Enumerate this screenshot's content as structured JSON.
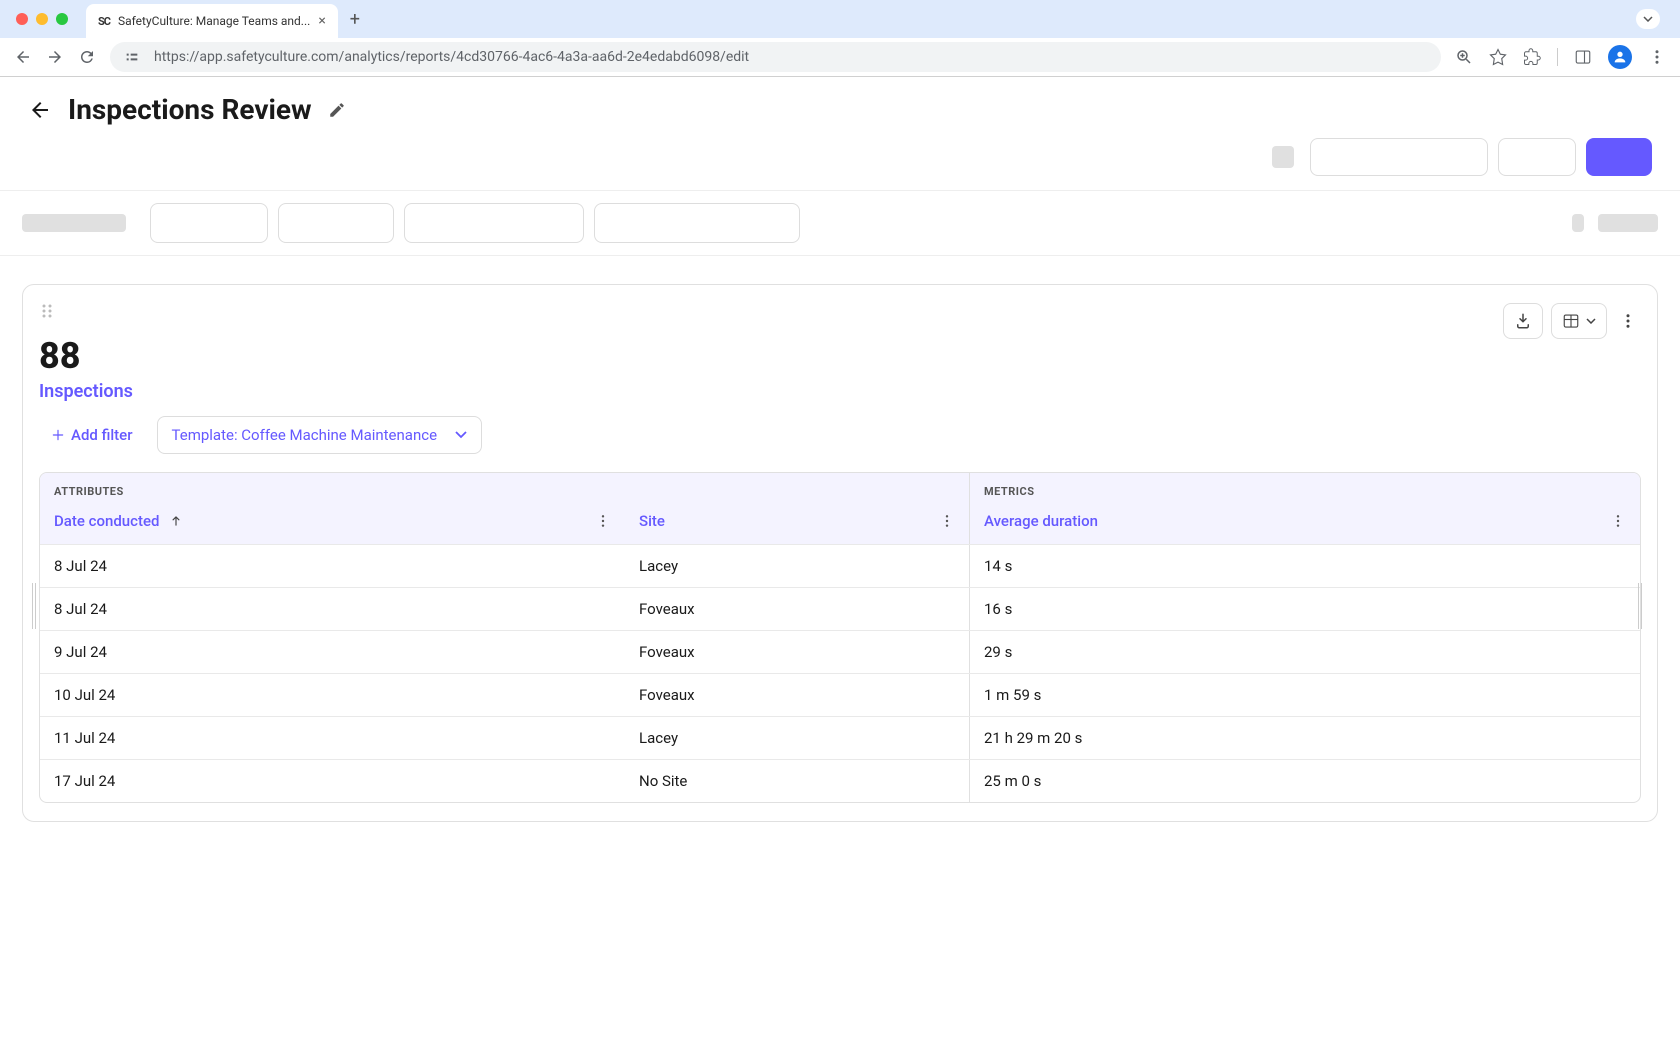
{
  "browser": {
    "tab_title": "SafetyCulture: Manage Teams and...",
    "url": "https://app.safetyculture.com/analytics/reports/4cd30766-4ac6-4a3a-aa6d-2e4edabd6098/edit"
  },
  "page": {
    "title": "Inspections Review"
  },
  "panel": {
    "count": "88",
    "label": "Inspections",
    "add_filter_label": "Add filter",
    "template_filter": "Template: Coffee Machine Maintenance"
  },
  "table": {
    "attributes_label": "ATTRIBUTES",
    "metrics_label": "METRICS",
    "columns": {
      "date": "Date conducted",
      "site": "Site",
      "avg_duration": "Average duration"
    },
    "rows": [
      {
        "date": "8 Jul 24",
        "site": "Lacey",
        "avg_duration": "14 s"
      },
      {
        "date": "8 Jul 24",
        "site": "Foveaux",
        "avg_duration": "16 s"
      },
      {
        "date": "9 Jul 24",
        "site": "Foveaux",
        "avg_duration": "29 s"
      },
      {
        "date": "10 Jul 24",
        "site": "Foveaux",
        "avg_duration": "1 m 59 s"
      },
      {
        "date": "11 Jul 24",
        "site": "Lacey",
        "avg_duration": "21 h 29 m 20 s"
      },
      {
        "date": "17 Jul 24",
        "site": "No Site",
        "avg_duration": "25 m 0 s"
      }
    ]
  }
}
